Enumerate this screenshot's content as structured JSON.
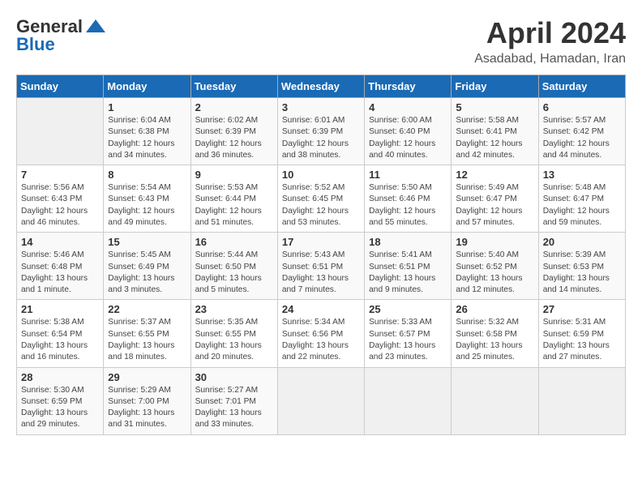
{
  "header": {
    "logo_general": "General",
    "logo_blue": "Blue",
    "month_year": "April 2024",
    "location": "Asadabad, Hamadan, Iran"
  },
  "weekdays": [
    "Sunday",
    "Monday",
    "Tuesday",
    "Wednesday",
    "Thursday",
    "Friday",
    "Saturday"
  ],
  "weeks": [
    [
      {
        "day": "",
        "info": ""
      },
      {
        "day": "1",
        "info": "Sunrise: 6:04 AM\nSunset: 6:38 PM\nDaylight: 12 hours\nand 34 minutes."
      },
      {
        "day": "2",
        "info": "Sunrise: 6:02 AM\nSunset: 6:39 PM\nDaylight: 12 hours\nand 36 minutes."
      },
      {
        "day": "3",
        "info": "Sunrise: 6:01 AM\nSunset: 6:39 PM\nDaylight: 12 hours\nand 38 minutes."
      },
      {
        "day": "4",
        "info": "Sunrise: 6:00 AM\nSunset: 6:40 PM\nDaylight: 12 hours\nand 40 minutes."
      },
      {
        "day": "5",
        "info": "Sunrise: 5:58 AM\nSunset: 6:41 PM\nDaylight: 12 hours\nand 42 minutes."
      },
      {
        "day": "6",
        "info": "Sunrise: 5:57 AM\nSunset: 6:42 PM\nDaylight: 12 hours\nand 44 minutes."
      }
    ],
    [
      {
        "day": "7",
        "info": "Sunrise: 5:56 AM\nSunset: 6:43 PM\nDaylight: 12 hours\nand 46 minutes."
      },
      {
        "day": "8",
        "info": "Sunrise: 5:54 AM\nSunset: 6:43 PM\nDaylight: 12 hours\nand 49 minutes."
      },
      {
        "day": "9",
        "info": "Sunrise: 5:53 AM\nSunset: 6:44 PM\nDaylight: 12 hours\nand 51 minutes."
      },
      {
        "day": "10",
        "info": "Sunrise: 5:52 AM\nSunset: 6:45 PM\nDaylight: 12 hours\nand 53 minutes."
      },
      {
        "day": "11",
        "info": "Sunrise: 5:50 AM\nSunset: 6:46 PM\nDaylight: 12 hours\nand 55 minutes."
      },
      {
        "day": "12",
        "info": "Sunrise: 5:49 AM\nSunset: 6:47 PM\nDaylight: 12 hours\nand 57 minutes."
      },
      {
        "day": "13",
        "info": "Sunrise: 5:48 AM\nSunset: 6:47 PM\nDaylight: 12 hours\nand 59 minutes."
      }
    ],
    [
      {
        "day": "14",
        "info": "Sunrise: 5:46 AM\nSunset: 6:48 PM\nDaylight: 13 hours\nand 1 minute."
      },
      {
        "day": "15",
        "info": "Sunrise: 5:45 AM\nSunset: 6:49 PM\nDaylight: 13 hours\nand 3 minutes."
      },
      {
        "day": "16",
        "info": "Sunrise: 5:44 AM\nSunset: 6:50 PM\nDaylight: 13 hours\nand 5 minutes."
      },
      {
        "day": "17",
        "info": "Sunrise: 5:43 AM\nSunset: 6:51 PM\nDaylight: 13 hours\nand 7 minutes."
      },
      {
        "day": "18",
        "info": "Sunrise: 5:41 AM\nSunset: 6:51 PM\nDaylight: 13 hours\nand 9 minutes."
      },
      {
        "day": "19",
        "info": "Sunrise: 5:40 AM\nSunset: 6:52 PM\nDaylight: 13 hours\nand 12 minutes."
      },
      {
        "day": "20",
        "info": "Sunrise: 5:39 AM\nSunset: 6:53 PM\nDaylight: 13 hours\nand 14 minutes."
      }
    ],
    [
      {
        "day": "21",
        "info": "Sunrise: 5:38 AM\nSunset: 6:54 PM\nDaylight: 13 hours\nand 16 minutes."
      },
      {
        "day": "22",
        "info": "Sunrise: 5:37 AM\nSunset: 6:55 PM\nDaylight: 13 hours\nand 18 minutes."
      },
      {
        "day": "23",
        "info": "Sunrise: 5:35 AM\nSunset: 6:55 PM\nDaylight: 13 hours\nand 20 minutes."
      },
      {
        "day": "24",
        "info": "Sunrise: 5:34 AM\nSunset: 6:56 PM\nDaylight: 13 hours\nand 22 minutes."
      },
      {
        "day": "25",
        "info": "Sunrise: 5:33 AM\nSunset: 6:57 PM\nDaylight: 13 hours\nand 23 minutes."
      },
      {
        "day": "26",
        "info": "Sunrise: 5:32 AM\nSunset: 6:58 PM\nDaylight: 13 hours\nand 25 minutes."
      },
      {
        "day": "27",
        "info": "Sunrise: 5:31 AM\nSunset: 6:59 PM\nDaylight: 13 hours\nand 27 minutes."
      }
    ],
    [
      {
        "day": "28",
        "info": "Sunrise: 5:30 AM\nSunset: 6:59 PM\nDaylight: 13 hours\nand 29 minutes."
      },
      {
        "day": "29",
        "info": "Sunrise: 5:29 AM\nSunset: 7:00 PM\nDaylight: 13 hours\nand 31 minutes."
      },
      {
        "day": "30",
        "info": "Sunrise: 5:27 AM\nSunset: 7:01 PM\nDaylight: 13 hours\nand 33 minutes."
      },
      {
        "day": "",
        "info": ""
      },
      {
        "day": "",
        "info": ""
      },
      {
        "day": "",
        "info": ""
      },
      {
        "day": "",
        "info": ""
      }
    ]
  ]
}
